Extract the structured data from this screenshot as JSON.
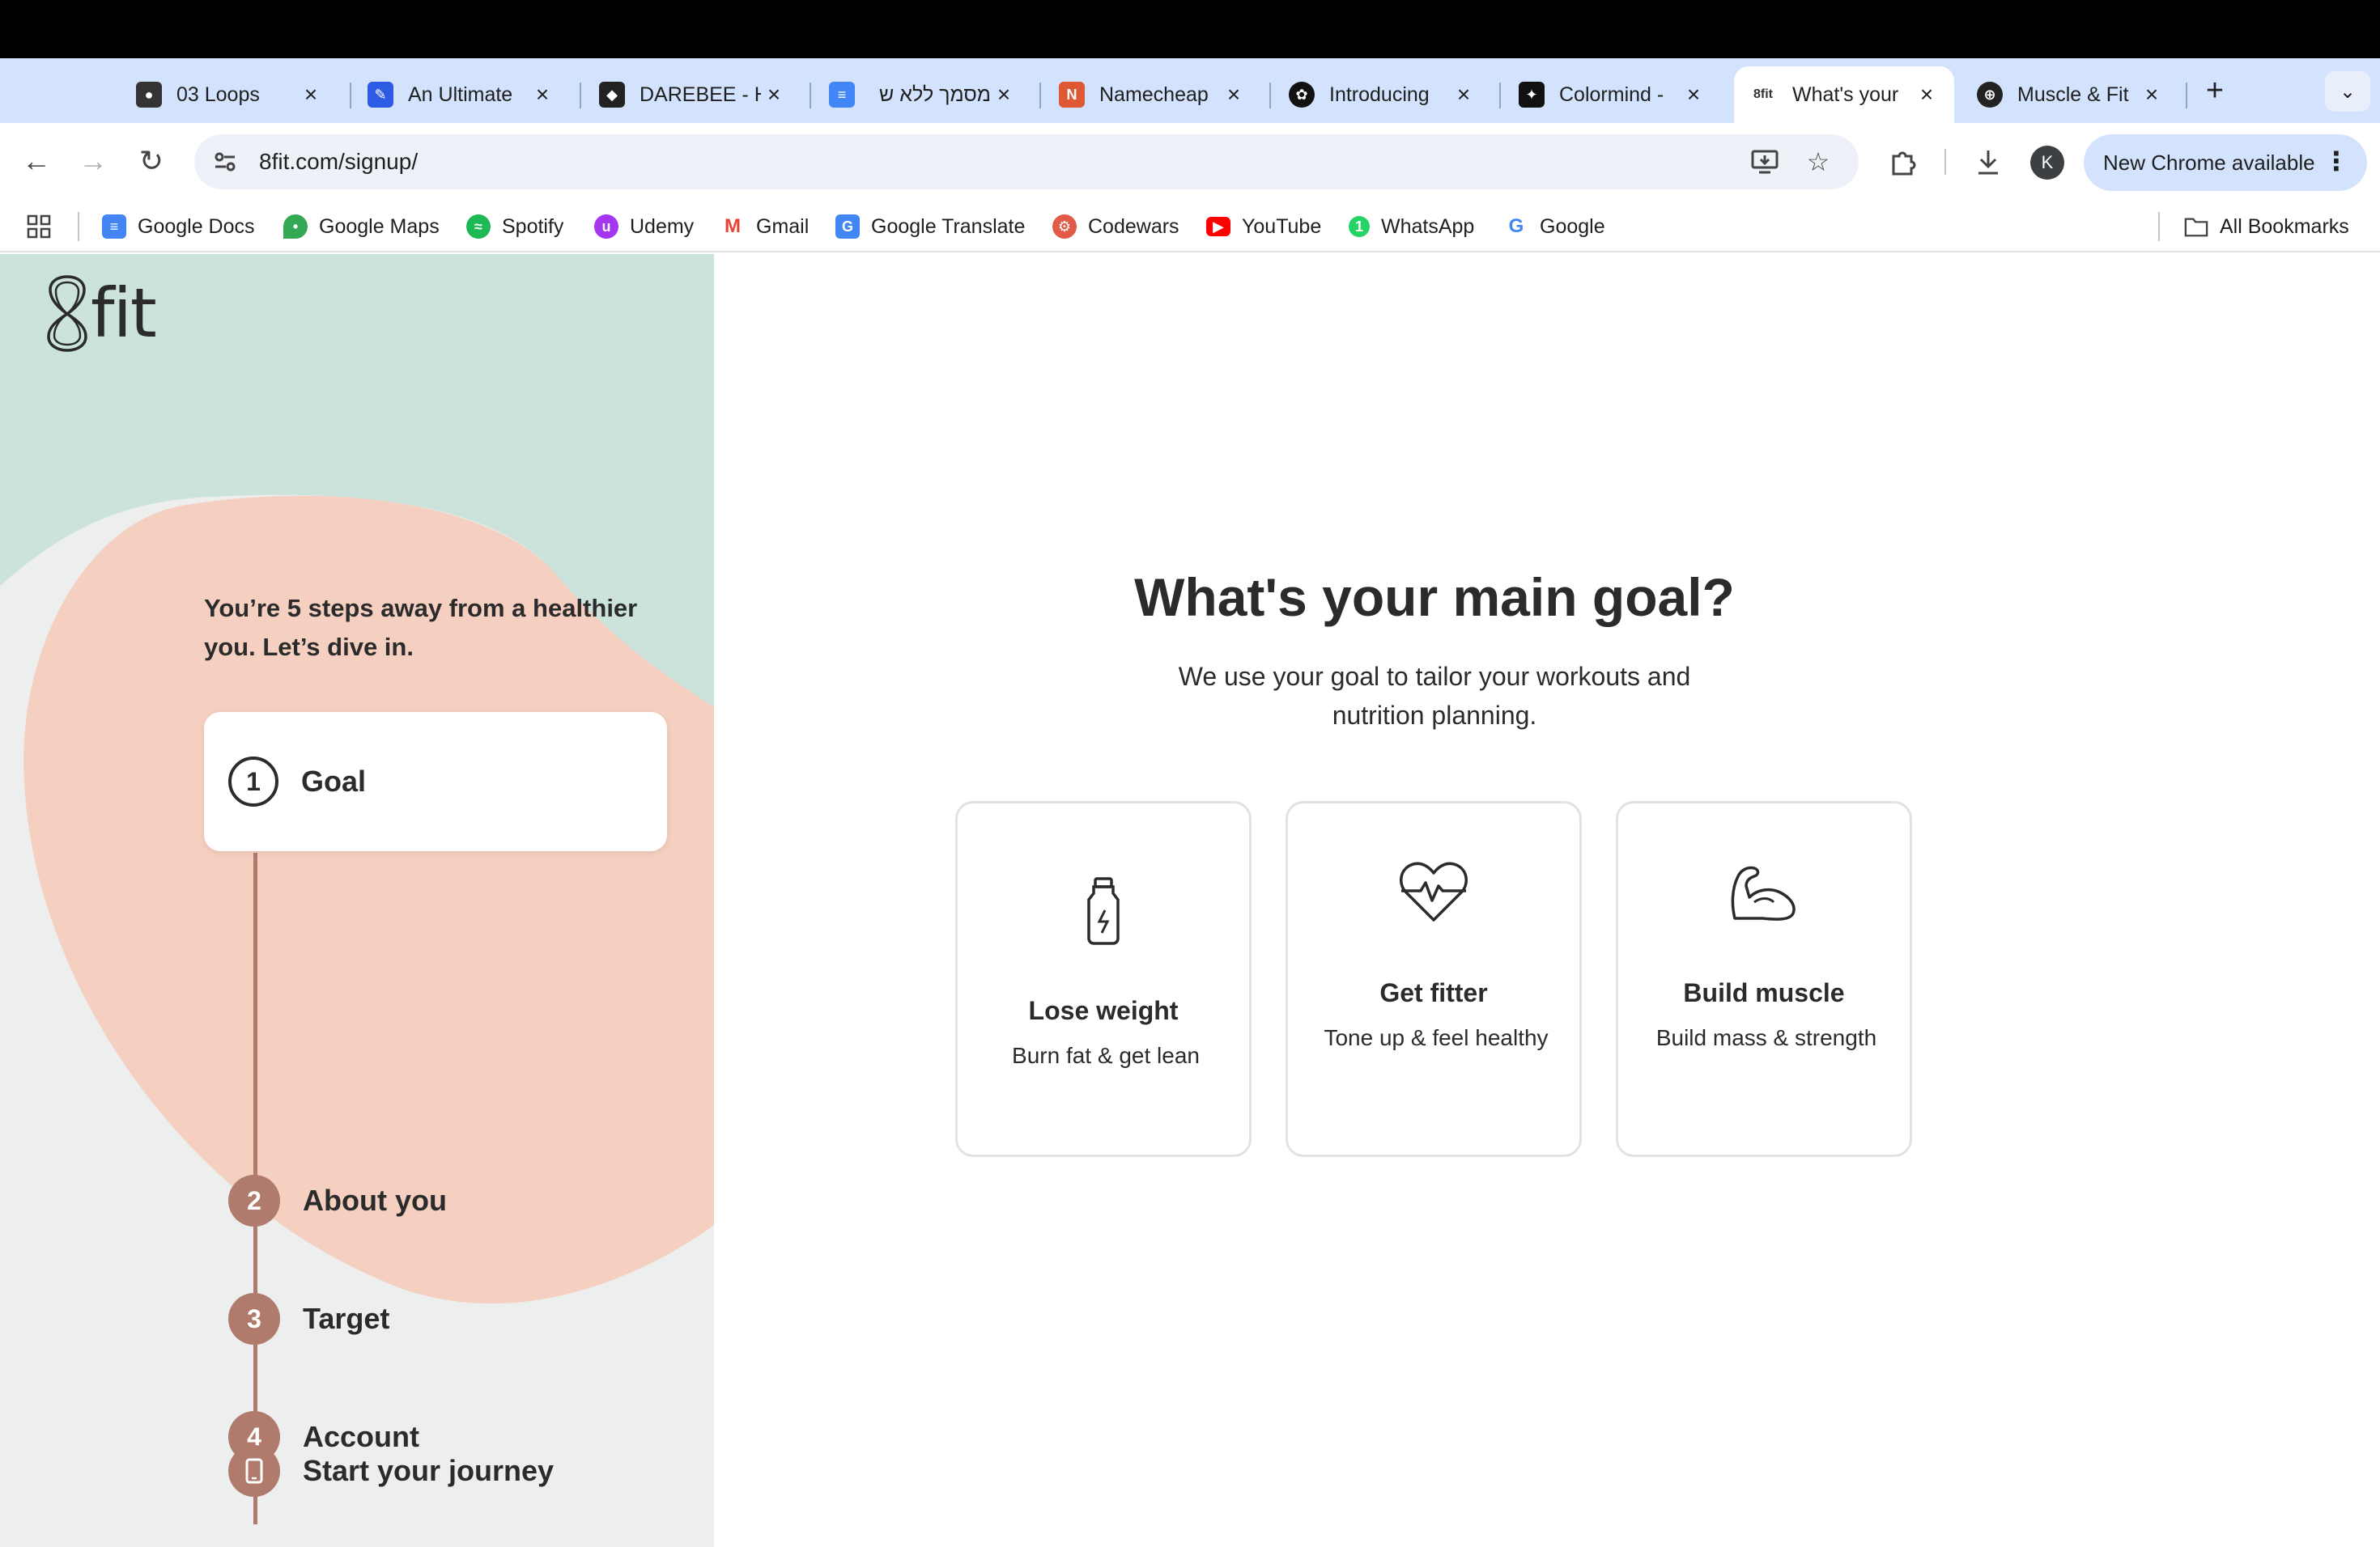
{
  "browser": {
    "tabs": [
      {
        "title": "03 Loops",
        "favicon": "person-photo-icon",
        "color": "#333333"
      },
      {
        "title": "An Ultimate",
        "favicon": "blue-square-icon",
        "color": "#2d5be3"
      },
      {
        "title": "DAREBEE - H",
        "favicon": "darebee-icon",
        "color": "#222222"
      },
      {
        "title": "מסמך ללא ש",
        "favicon": "google-docs-icon",
        "color": "#4285f4"
      },
      {
        "title": "Namecheap",
        "favicon": "namecheap-icon",
        "color": "#de5833"
      },
      {
        "title": "Introducing",
        "favicon": "openai-icon",
        "color": "#111111"
      },
      {
        "title": "Colormind -",
        "favicon": "colormind-icon",
        "color": "#111111"
      },
      {
        "title": "What's your",
        "favicon": "8fit-icon",
        "color": "#ffffff",
        "active": true
      },
      {
        "title": "Muscle & Fit",
        "favicon": "dumbbell-icon",
        "color": "#222222"
      }
    ],
    "url": "8fit.com/signup/",
    "profile_initial": "K",
    "update_label": "New Chrome available",
    "bookmarks": [
      {
        "label": "Google Docs",
        "icon": "google-docs-icon",
        "color": "#4285f4"
      },
      {
        "label": "Google Maps",
        "icon": "google-maps-icon",
        "color": "#34a853"
      },
      {
        "label": "Spotify",
        "icon": "spotify-icon",
        "color": "#1db954"
      },
      {
        "label": "Udemy",
        "icon": "udemy-icon",
        "color": "#a435f0"
      },
      {
        "label": "Gmail",
        "icon": "gmail-icon",
        "color": "#ea4335"
      },
      {
        "label": "Google Translate",
        "icon": "google-translate-icon",
        "color": "#4285f4"
      },
      {
        "label": "Codewars",
        "icon": "codewars-icon",
        "color": "#e05a47"
      },
      {
        "label": "YouTube",
        "icon": "youtube-icon",
        "color": "#ff0000"
      },
      {
        "label": "WhatsApp",
        "icon": "whatsapp-icon",
        "color": "#25d366"
      },
      {
        "label": "Google",
        "icon": "google-icon",
        "color": "#4285f4"
      }
    ],
    "all_bookmarks_label": "All Bookmarks"
  },
  "sidebar": {
    "logo_text": "fit",
    "intro": "You’re 5 steps away from a healthier you. Let’s dive in.",
    "current_step": {
      "number": "1",
      "label": "Goal"
    },
    "steps": [
      {
        "number": "2",
        "label": "About you"
      },
      {
        "number": "3",
        "label": "Target"
      },
      {
        "number": "4",
        "label": "Account"
      },
      {
        "number": "",
        "label": "Start your journey",
        "icon": "phone-icon"
      }
    ]
  },
  "main": {
    "heading": "What's your main goal?",
    "subheading": "We use your goal to tailor your workouts and nutrition planning.",
    "options": [
      {
        "title": "Lose weight",
        "description": "Burn fat & get lean",
        "icon": "bottle-icon"
      },
      {
        "title": "Get fitter",
        "description": "Tone up & feel healthy",
        "icon": "heartbeat-icon"
      },
      {
        "title": "Build muscle",
        "description": "Build mass & strength",
        "icon": "flexed-arm-icon"
      }
    ]
  },
  "colors": {
    "mint": "#cbe3da",
    "peach": "#f5cfc0",
    "step_brown": "#b07a6c",
    "text": "#2b2b2b"
  }
}
